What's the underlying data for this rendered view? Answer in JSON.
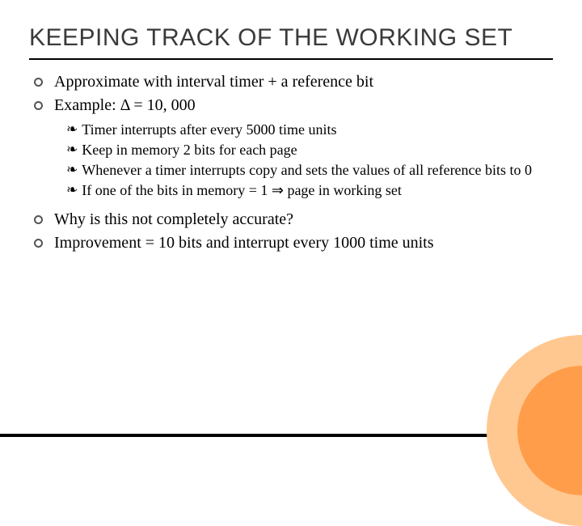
{
  "title": "KEEPING TRACK OF THE WORKING SET",
  "bullets_top": [
    "Approximate with interval timer + a reference bit",
    "Example: Δ = 10, 000"
  ],
  "sub_bullets": [
    "Timer interrupts after every 5000 time units",
    "Keep in memory 2 bits for each page",
    "Whenever a timer interrupts copy and sets the values of all reference bits to 0",
    "If one of the bits in memory = 1 ⇒ page in working set"
  ],
  "bullets_bottom": [
    "Why is this not completely accurate?",
    "Improvement = 10 bits and interrupt every 1000 time units"
  ]
}
